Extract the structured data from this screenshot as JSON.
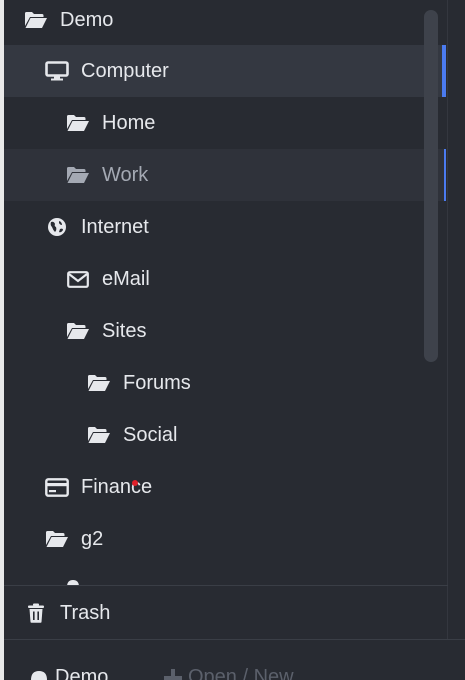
{
  "tree": {
    "items": [
      {
        "label": "Demo",
        "icon": "folder-open-icon"
      },
      {
        "label": "Computer",
        "icon": "monitor-icon"
      },
      {
        "label": "Home",
        "icon": "folder-open-icon"
      },
      {
        "label": "Work",
        "icon": "folder-open-icon"
      },
      {
        "label": "Internet",
        "icon": "globe-icon"
      },
      {
        "label": "eMail",
        "icon": "envelope-icon"
      },
      {
        "label": "Sites",
        "icon": "folder-open-icon"
      },
      {
        "label": "Forums",
        "icon": "folder-open-icon"
      },
      {
        "label": "Social",
        "icon": "folder-open-icon"
      },
      {
        "label": "Finance",
        "icon": "credit-card-icon"
      },
      {
        "label": "g2",
        "icon": "folder-open-icon"
      }
    ]
  },
  "footer": {
    "trash_label": "Trash",
    "trash_icon": "trash-icon"
  },
  "bottom": {
    "vault_label": "Demo",
    "open_new_label": "Open / New"
  },
  "colors": {
    "panel": "#282b32",
    "selected": "#343841",
    "accent": "#4b7bf0",
    "text": "#e6e8ec"
  }
}
